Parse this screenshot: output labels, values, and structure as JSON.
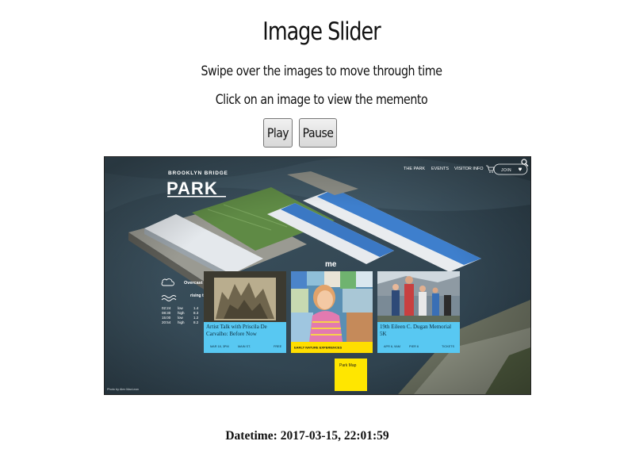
{
  "page": {
    "title": "Image Slider",
    "instruction_swipe": "Swipe over the images to move through time",
    "instruction_click": "Click on an image to view the memento"
  },
  "controls": {
    "play_label": "Play",
    "pause_label": "Pause"
  },
  "memento": {
    "site": {
      "logo_small": "BROOKLYN BRIDGE",
      "logo_large": "PARK",
      "nav": [
        "THE PARK",
        "EVENTS",
        "VISITOR INFO"
      ],
      "join_label": "JOIN",
      "weather_label": "Overcast",
      "tide_label": "rising tide",
      "section_heading": "me",
      "tides": [
        {
          "time": "02:24",
          "level": "low",
          "value": "1.4"
        },
        {
          "time": "08:30",
          "level": "high",
          "value": "8.3"
        },
        {
          "time": "15:00",
          "level": "low",
          "value": "1.2"
        },
        {
          "time": "20:54",
          "level": "high",
          "value": "8.2"
        }
      ],
      "cards": [
        {
          "title": "Artist Talk with Priscila De Carvalho: Before Now",
          "date": "MAR 18, 3PM",
          "place": "MAIN ST.",
          "price": "FREE",
          "theme": "blue"
        },
        {
          "title": "EARLY NATURE EXPERIENCES",
          "date": "",
          "place": "",
          "price": "",
          "theme": "yellow"
        },
        {
          "title": "19th Eileen C. Dugan Memorial 5K",
          "date": "APR 6, 9AM",
          "place": "PIER 6",
          "price": "TICKETS",
          "theme": "blue"
        }
      ],
      "map_button": "Park Map",
      "photo_credit": "Photo by Alex MacLean"
    },
    "colors": {
      "card_blue": "#58c8f2",
      "card_yellow": "#ffde00",
      "map_yellow": "#ffe600"
    }
  },
  "status": {
    "datetime_label": "Datetime:",
    "datetime_value": "2017-03-15, 22:01:59"
  }
}
